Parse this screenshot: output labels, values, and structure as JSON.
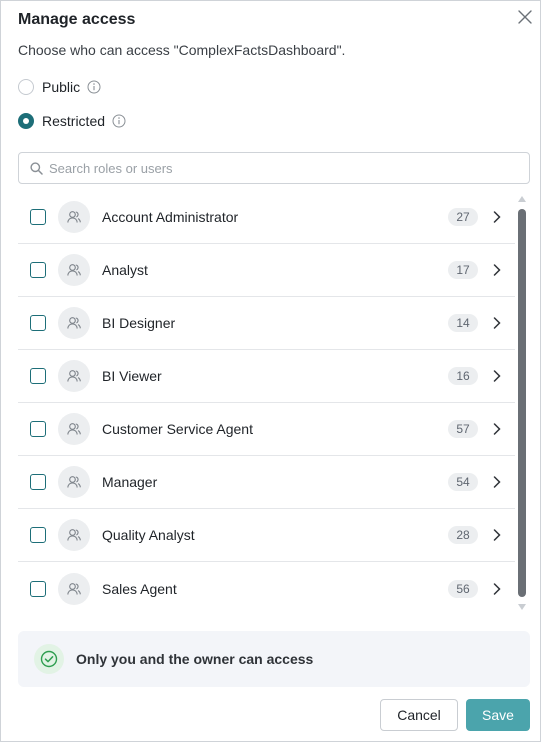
{
  "dialog": {
    "title": "Manage access",
    "subtitle": "Choose who can access \"ComplexFactsDashboard\"."
  },
  "visibility": {
    "options": [
      {
        "label": "Public",
        "selected": false
      },
      {
        "label": "Restricted",
        "selected": true
      }
    ]
  },
  "search": {
    "placeholder": "Search roles or users",
    "value": ""
  },
  "roles": [
    {
      "name": "Account Administrator",
      "count": "27",
      "checked": false
    },
    {
      "name": "Analyst",
      "count": "17",
      "checked": false
    },
    {
      "name": "BI Designer",
      "count": "14",
      "checked": false
    },
    {
      "name": "BI Viewer",
      "count": "16",
      "checked": false
    },
    {
      "name": "Customer Service Agent",
      "count": "57",
      "checked": false
    },
    {
      "name": "Manager",
      "count": "54",
      "checked": false
    },
    {
      "name": "Quality Analyst",
      "count": "28",
      "checked": false
    },
    {
      "name": "Sales Agent",
      "count": "56",
      "checked": false
    }
  ],
  "banner": {
    "text": "Only you and the owner can access",
    "icon": "check-circle-icon"
  },
  "footer": {
    "cancel_label": "Cancel",
    "save_label": "Save"
  },
  "colors": {
    "accent": "#1d6e78",
    "save_button": "#4ba4ac",
    "banner_bg": "#f3f5f9",
    "success": "#2e9e4f"
  }
}
